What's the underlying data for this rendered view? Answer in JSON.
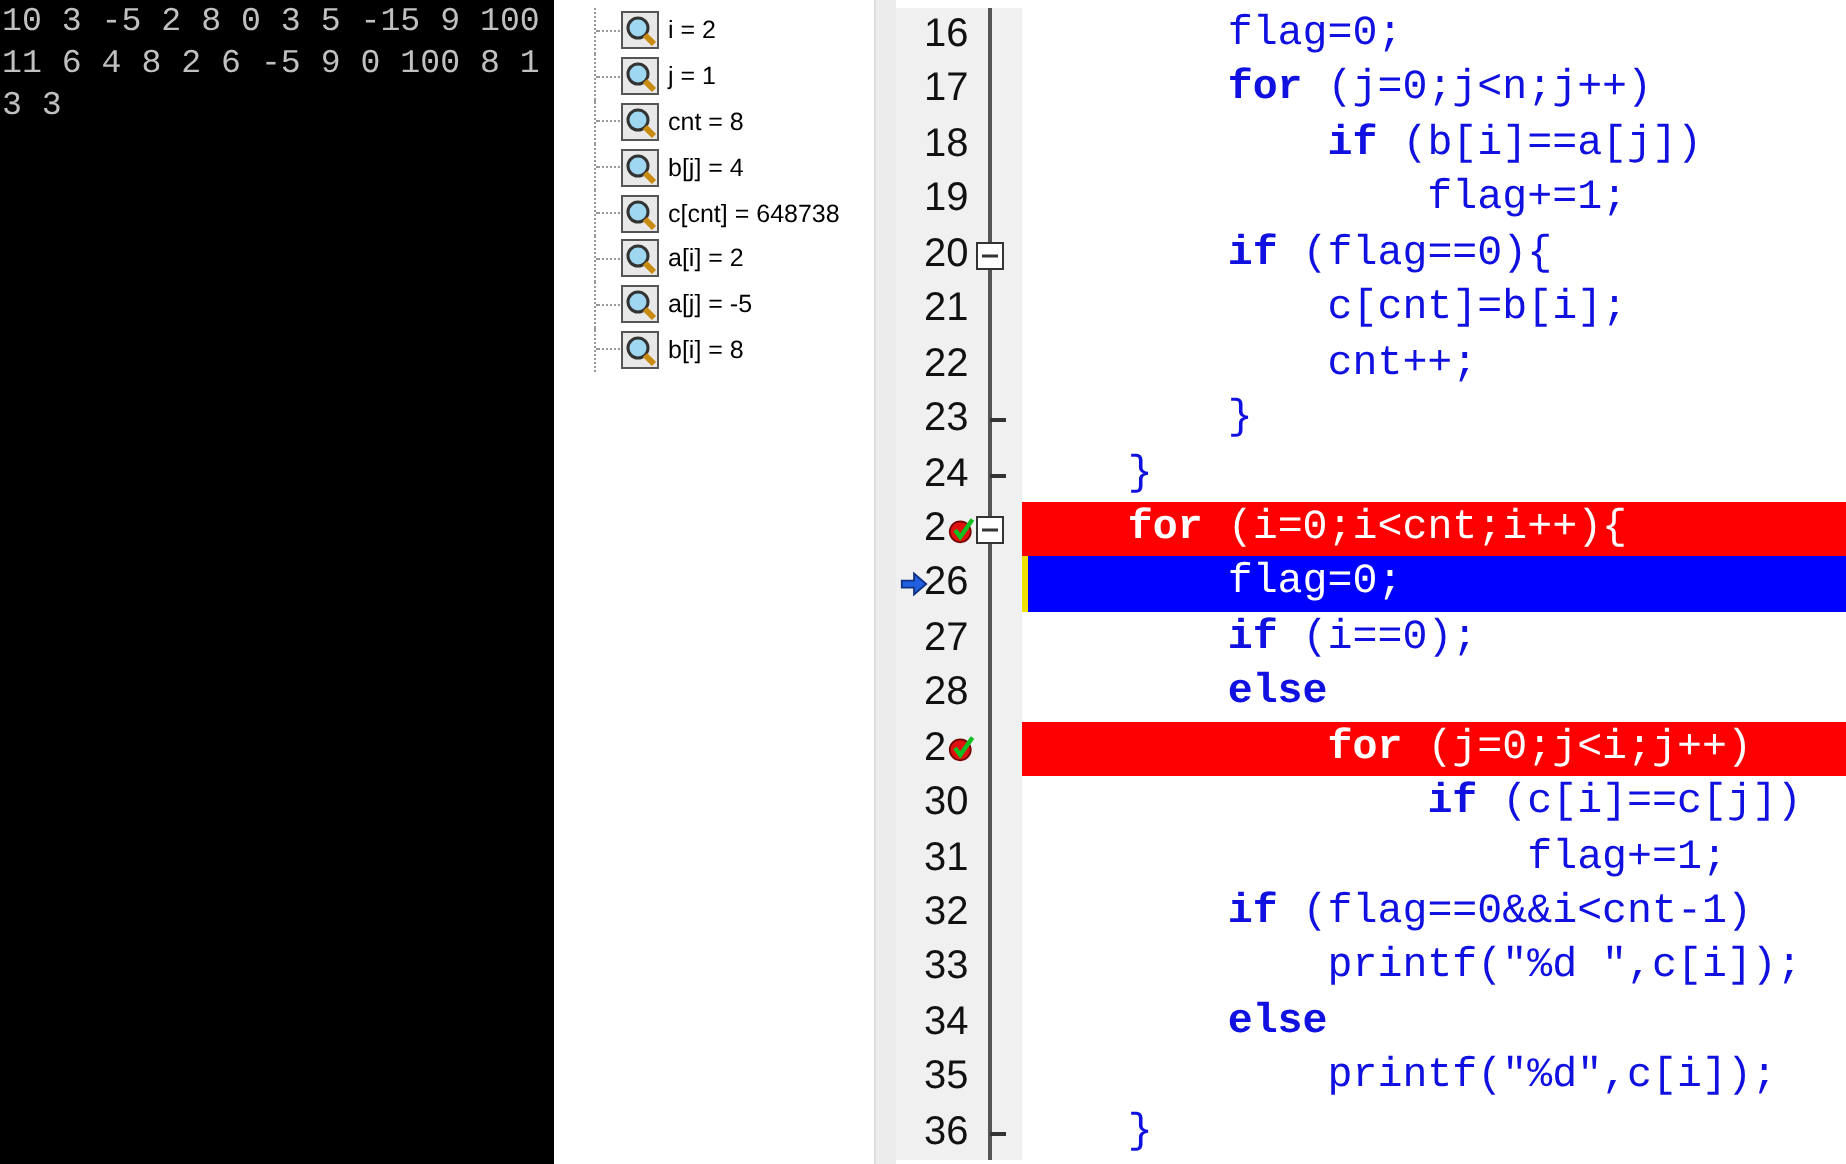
{
  "console": {
    "lines": [
      "10 3 -5 2 8 0 3 5 -15 9 100",
      "11 6 4 8 2 6 -5 9 0 100 8 1",
      "3 3"
    ]
  },
  "watches": [
    {
      "text": "i = 2"
    },
    {
      "text": "j = 1"
    },
    {
      "text": "cnt = 8"
    },
    {
      "text": "b[j] = 4"
    },
    {
      "text": "c[cnt] = 648738"
    },
    {
      "text": "a[i] = 2"
    },
    {
      "text": "a[j] = -5"
    },
    {
      "text": "b[i] = 8"
    }
  ],
  "code": [
    {
      "number": "16",
      "text": "        flag=0;",
      "breakpoint": false,
      "current": false
    },
    {
      "number": "17",
      "text": "        **for** (j=0;j<n;j++)",
      "breakpoint": false,
      "current": false
    },
    {
      "number": "18",
      "text": "            **if** (b[i]==a[j])",
      "breakpoint": false,
      "current": false
    },
    {
      "number": "19",
      "text": "                flag+=1;",
      "breakpoint": false,
      "current": false
    },
    {
      "number": "20",
      "text": "        **if** (flag==0){",
      "breakpoint": false,
      "current": false,
      "fold_start": true
    },
    {
      "number": "21",
      "text": "            c[cnt]=b[i];",
      "breakpoint": false,
      "current": false
    },
    {
      "number": "22",
      "text": "            cnt++;",
      "breakpoint": false,
      "current": false
    },
    {
      "number": "23",
      "text": "        }",
      "breakpoint": false,
      "current": false,
      "fold_end": true
    },
    {
      "number": "24",
      "text": "    }",
      "breakpoint": false,
      "current": false,
      "fold_end": true
    },
    {
      "number": "2",
      "text": "    **for** (i=0;i<cnt;i++){",
      "breakpoint": true,
      "current": false,
      "fold_start": true
    },
    {
      "number": "26",
      "text": "        flag=0;",
      "breakpoint": false,
      "current": true
    },
    {
      "number": "27",
      "text": "        **if** (i==0);",
      "breakpoint": false,
      "current": false
    },
    {
      "number": "28",
      "text": "        **else**",
      "breakpoint": false,
      "current": false
    },
    {
      "number": "2",
      "text": "            **for** (j=0;j<i;j++)",
      "breakpoint": true,
      "current": false
    },
    {
      "number": "30",
      "text": "                **if** (c[i]==c[j])",
      "breakpoint": false,
      "current": false
    },
    {
      "number": "31",
      "text": "                    flag+=1;",
      "breakpoint": false,
      "current": false
    },
    {
      "number": "32",
      "text": "        **if** (flag==0&&i<cnt-1)",
      "breakpoint": false,
      "current": false
    },
    {
      "number": "33",
      "text": "            printf(\"%d \",c[i]);",
      "breakpoint": false,
      "current": false
    },
    {
      "number": "34",
      "text": "        **else**",
      "breakpoint": false,
      "current": false
    },
    {
      "number": "35",
      "text": "            printf(\"%d\",c[i]);",
      "breakpoint": false,
      "current": false
    },
    {
      "number": "36",
      "text": "    }",
      "breakpoint": false,
      "current": false,
      "fold_end": true
    }
  ]
}
